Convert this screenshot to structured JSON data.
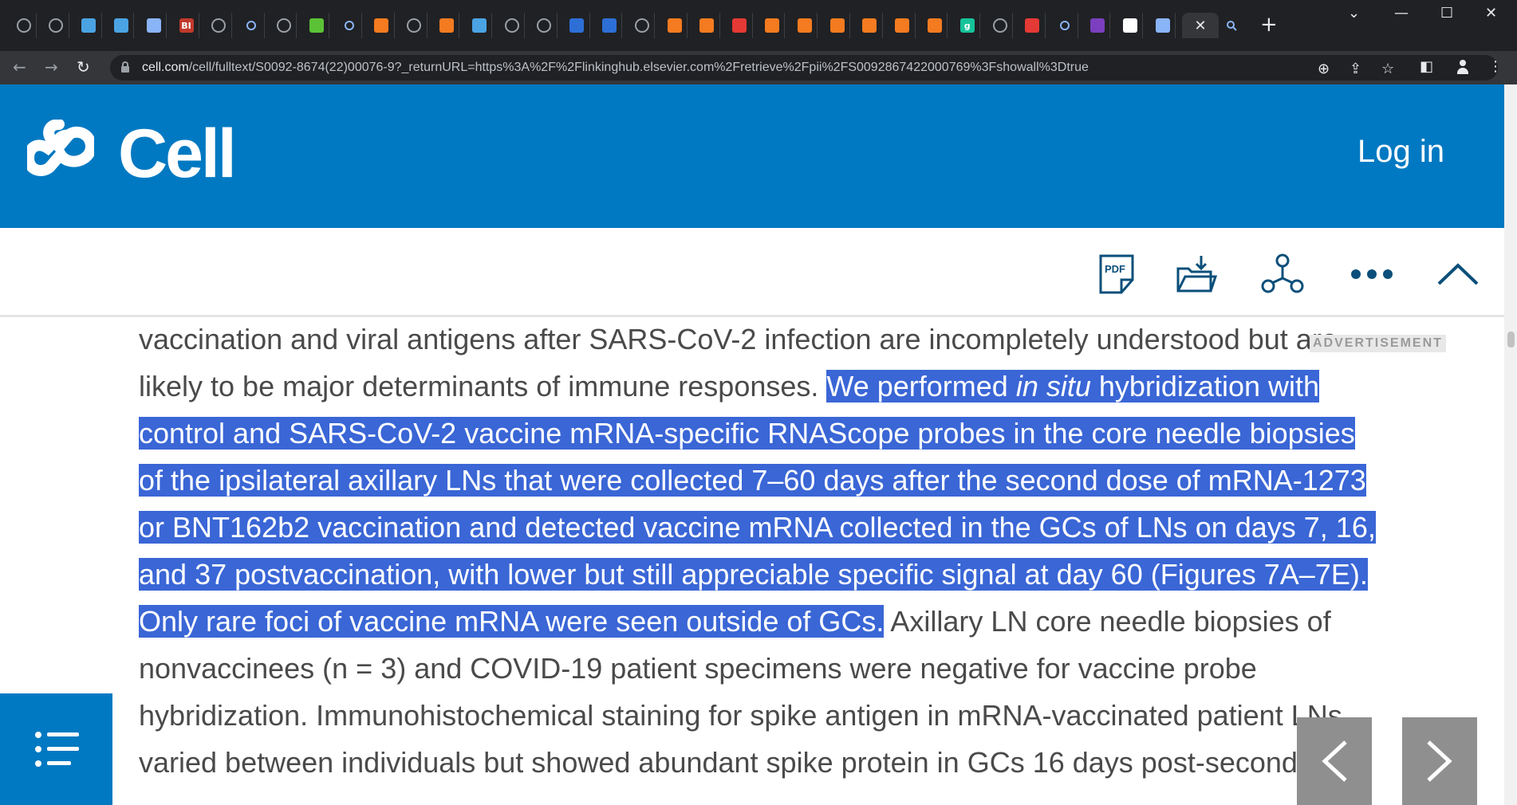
{
  "browser": {
    "url_host": "cell.com",
    "url_path": "/cell/fulltext/S0092-8674(22)00076-9?_returnURL=https%3A%2F%2Flinkinghub.elsevier.com%2Fretrieve%2Fpii%2FS0092867422000769%3Fshowall%3Dtrue",
    "active_tab_close": "✕",
    "new_tab": "+",
    "tabs": [
      {
        "icon": "globe-icon",
        "color": "#9aa0a6",
        "glyph": ""
      },
      {
        "icon": "globe-icon",
        "color": "#9aa0a6",
        "glyph": ""
      },
      {
        "icon": "shield-icon",
        "color": "#4ba3e3",
        "glyph": ""
      },
      {
        "icon": "shield-icon",
        "color": "#4ba3e3",
        "glyph": ""
      },
      {
        "icon": "arrow-icon",
        "color": "#8ab4f8",
        "glyph": ""
      },
      {
        "icon": "bi-icon",
        "color": "#c0392b",
        "glyph": "BI"
      },
      {
        "icon": "globe-icon",
        "color": "#9aa0a6",
        "glyph": ""
      },
      {
        "icon": "search-icon",
        "color": "#8ab4f8",
        "glyph": ""
      },
      {
        "icon": "globe-icon",
        "color": "#9aa0a6",
        "glyph": ""
      },
      {
        "icon": "play-icon",
        "color": "#5bc236",
        "glyph": ""
      },
      {
        "icon": "search-icon",
        "color": "#8ab4f8",
        "glyph": ""
      },
      {
        "icon": "bookmark-icon",
        "color": "#f47b20",
        "glyph": ""
      },
      {
        "icon": "globe-icon",
        "color": "#9aa0a6",
        "glyph": ""
      },
      {
        "icon": "bookmark-icon",
        "color": "#f47b20",
        "glyph": ""
      },
      {
        "icon": "shield-icon",
        "color": "#4ba3e3",
        "glyph": ""
      },
      {
        "icon": "globe-icon",
        "color": "#9aa0a6",
        "glyph": ""
      },
      {
        "icon": "globe-icon",
        "color": "#9aa0a6",
        "glyph": ""
      },
      {
        "icon": "cube-icon",
        "color": "#2d6fd6",
        "glyph": ""
      },
      {
        "icon": "cube-icon",
        "color": "#2d6fd6",
        "glyph": ""
      },
      {
        "icon": "globe-icon",
        "color": "#9aa0a6",
        "glyph": ""
      },
      {
        "icon": "badge-icon",
        "color": "#f47b20",
        "glyph": ""
      },
      {
        "icon": "badge-icon",
        "color": "#f47b20",
        "glyph": ""
      },
      {
        "icon": "pin-icon",
        "color": "#e53935",
        "glyph": ""
      },
      {
        "icon": "bookmark-icon",
        "color": "#f47b20",
        "glyph": ""
      },
      {
        "icon": "bookmark-icon",
        "color": "#f47b20",
        "glyph": ""
      },
      {
        "icon": "bookmark-icon",
        "color": "#f47b20",
        "glyph": ""
      },
      {
        "icon": "bookmark-icon",
        "color": "#f47b20",
        "glyph": ""
      },
      {
        "icon": "bookmark-icon",
        "color": "#f47b20",
        "glyph": ""
      },
      {
        "icon": "bookmark-icon",
        "color": "#f47b20",
        "glyph": ""
      },
      {
        "icon": "grammarly-icon",
        "color": "#15c39a",
        "glyph": "g"
      },
      {
        "icon": "globe-icon",
        "color": "#9aa0a6",
        "glyph": ""
      },
      {
        "icon": "pin-icon",
        "color": "#e53935",
        "glyph": ""
      },
      {
        "icon": "search-icon",
        "color": "#8ab4f8",
        "glyph": ""
      },
      {
        "icon": "mail-icon",
        "color": "#7b3fbf",
        "glyph": ""
      },
      {
        "icon": "square-icon",
        "color": "#ffffff",
        "glyph": ""
      },
      {
        "icon": "arrow-icon",
        "color": "#8ab4f8",
        "glyph": ""
      }
    ],
    "extra_tab_icon": "search-icon"
  },
  "site": {
    "logo_text": "Cell",
    "login_label": "Log in",
    "brand_color": "#0079c2"
  },
  "article_toolbar": {
    "pdf_label": "PDF"
  },
  "article": {
    "p1": "vaccination and viral antigens after SARS-CoV-2 infection are incompletely understood but are likely to be major determinants of immune responses. ",
    "hl1": "We performed ",
    "hl_em": "in situ",
    "hl2": " hybridization with control and SARS-CoV-2 vaccine mRNA-specific RNAScope probes in the core needle biopsies of the ipsilateral axillary LNs that were collected 7–60 days after the second dose of mRNA-1273 or BNT162b2 vaccination and detected vaccine mRNA collected in the GCs of LNs on days 7, 16, and 37 postvaccination, with lower but still appreciable specific signal at day 60 (Figures 7A–7E). Only rare foci of vaccine mRNA were seen outside of GCs.",
    "p2": " Axillary LN core needle biopsies of nonvaccinees (n = 3) and COVID-19 patient specimens were negative for vaccine probe hybridization. Immunohistochemical staining for spike antigen in mRNA-vaccinated patient LNs varied between individuals but showed abundant spike protein in GCs 16 days post-second",
    "advertisement": "ADVERTISEMENT"
  }
}
